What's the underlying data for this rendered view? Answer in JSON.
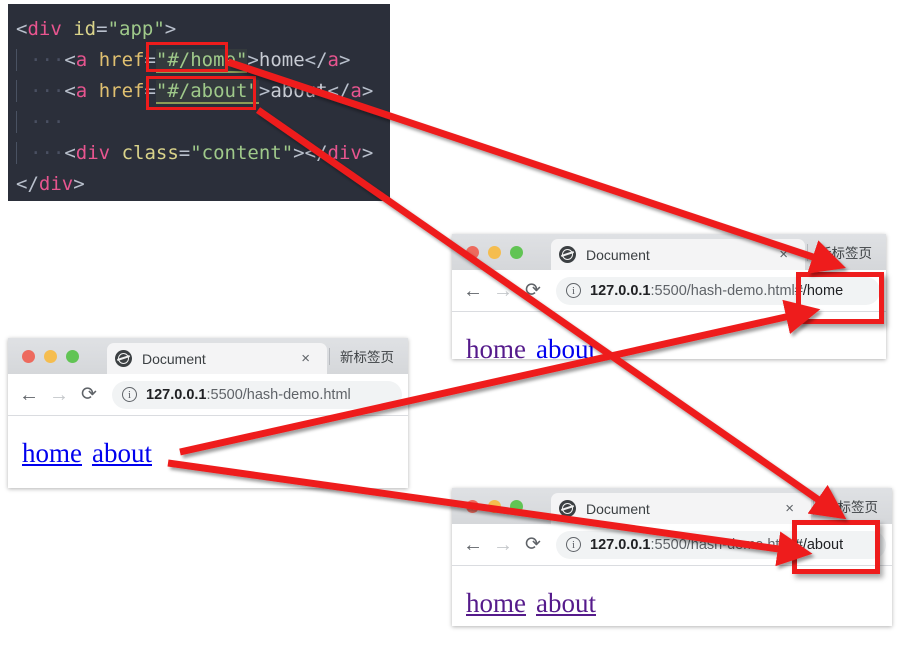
{
  "editor": {
    "name": "html-code-snippet",
    "background": "#2b2f3a",
    "lines": [
      {
        "id": "line-div-app-open",
        "tokens": [
          {
            "t": "<",
            "c": "tok-punct"
          },
          {
            "t": "div",
            "c": "tok-tag"
          },
          {
            "t": " ",
            "c": "tok-punct"
          },
          {
            "t": "id",
            "c": "tok-attr2"
          },
          {
            "t": "=",
            "c": "tok-punct"
          },
          {
            "t": "\"app\"",
            "c": "tok-str"
          },
          {
            "t": ">",
            "c": "tok-punct"
          }
        ]
      },
      {
        "id": "line-a-home",
        "tokens": [
          {
            "t": "<",
            "c": "tok-punct"
          },
          {
            "t": "a",
            "c": "tok-tag"
          },
          {
            "t": " ",
            "c": "tok-punct"
          },
          {
            "t": "href",
            "c": "tok-attr"
          },
          {
            "t": "=",
            "c": "tok-punct"
          },
          {
            "t": "\"#/home\"",
            "c": "tok-str",
            "hl": true
          },
          {
            "t": ">",
            "c": "tok-punct"
          },
          {
            "t": "home",
            "c": "tok-text"
          },
          {
            "t": "</",
            "c": "tok-punct"
          },
          {
            "t": "a",
            "c": "tok-tag"
          },
          {
            "t": ">",
            "c": "tok-punct"
          }
        ]
      },
      {
        "id": "line-a-about",
        "tokens": [
          {
            "t": "<",
            "c": "tok-punct"
          },
          {
            "t": "a",
            "c": "tok-tag"
          },
          {
            "t": " ",
            "c": "tok-punct"
          },
          {
            "t": "href",
            "c": "tok-attr"
          },
          {
            "t": "=",
            "c": "tok-punct"
          },
          {
            "t": "\"#/about\"",
            "c": "tok-str",
            "hl": true
          },
          {
            "t": ">",
            "c": "tok-punct"
          },
          {
            "t": "about",
            "c": "tok-text"
          },
          {
            "t": "</",
            "c": "tok-punct"
          },
          {
            "t": "a",
            "c": "tok-tag"
          },
          {
            "t": ">",
            "c": "tok-punct"
          }
        ]
      },
      {
        "id": "line-blank",
        "tokens": []
      },
      {
        "id": "line-div-content",
        "tokens": [
          {
            "t": "<",
            "c": "tok-punct"
          },
          {
            "t": "div",
            "c": "tok-tag"
          },
          {
            "t": " ",
            "c": "tok-punct"
          },
          {
            "t": "class",
            "c": "tok-attr2"
          },
          {
            "t": "=",
            "c": "tok-punct"
          },
          {
            "t": "\"content\"",
            "c": "tok-str"
          },
          {
            "t": ">",
            "c": "tok-punct"
          },
          {
            "t": "</",
            "c": "tok-punct"
          },
          {
            "t": "div",
            "c": "tok-tag"
          },
          {
            "t": ">",
            "c": "tok-punct"
          }
        ]
      },
      {
        "id": "line-div-app-close",
        "tokens": [
          {
            "t": "</",
            "c": "tok-punct"
          },
          {
            "t": "div",
            "c": "tok-tag"
          },
          {
            "t": ">",
            "c": "tok-punct"
          }
        ]
      }
    ]
  },
  "browsers": {
    "left": {
      "id": "browser-left",
      "tab_title": "Document",
      "close_label": "×",
      "newtab_label": "新标签页",
      "back_label": "←",
      "forward_label": "→",
      "reload_label": "⟳",
      "info_label": "i",
      "url_host": "127.0.0.1",
      "url_path": ":5500/hash-demo.html",
      "url_hash": "",
      "links": [
        {
          "label": "home",
          "state": "unvisited"
        },
        {
          "label": "about",
          "state": "unvisited"
        }
      ]
    },
    "middle": {
      "id": "browser-middle",
      "tab_title": "Document",
      "close_label": "×",
      "newtab_label": "新标签页",
      "back_label": "←",
      "forward_label": "→",
      "reload_label": "⟳",
      "info_label": "i",
      "url_host": "127.0.0.1",
      "url_path": ":5500/hash-demo.html",
      "url_hash": "#/home",
      "links": [
        {
          "label": "home",
          "state": "visited"
        },
        {
          "label": "about",
          "state": "unvisited"
        }
      ]
    },
    "bottom": {
      "id": "browser-bottom",
      "tab_title": "Document",
      "close_label": "×",
      "newtab_label": "新标签页",
      "back_label": "←",
      "forward_label": "→",
      "reload_label": "⟳",
      "info_label": "i",
      "url_host": "127.0.0.1",
      "url_path": ":5500/hash-demo.html",
      "url_hash": "#/about",
      "links": [
        {
          "label": "home",
          "state": "visited"
        },
        {
          "label": "about",
          "state": "visited"
        }
      ]
    }
  },
  "annotations": {
    "color": "#ee1c1c",
    "boxes": [
      {
        "name": "code-highlight-home",
        "target": "\"#/home\""
      },
      {
        "name": "code-highlight-about",
        "target": "\"#/about\""
      },
      {
        "name": "url-highlight-home",
        "target": "#/home"
      },
      {
        "name": "url-highlight-about",
        "target": "#/about"
      }
    ],
    "arrows": [
      {
        "name": "arrow-code-home-to-url-home",
        "from": "code \"#/home\"",
        "to": "middle browser url #/home box"
      },
      {
        "name": "arrow-code-about-to-url-about",
        "from": "code \"#/about\"",
        "to": "bottom browser url #/about box"
      },
      {
        "name": "arrow-left-about-to-url-home",
        "from": "left browser about link",
        "to": "middle browser url hash"
      },
      {
        "name": "arrow-left-about-to-url-about",
        "from": "left browser about link",
        "to": "bottom browser url hash"
      }
    ]
  }
}
